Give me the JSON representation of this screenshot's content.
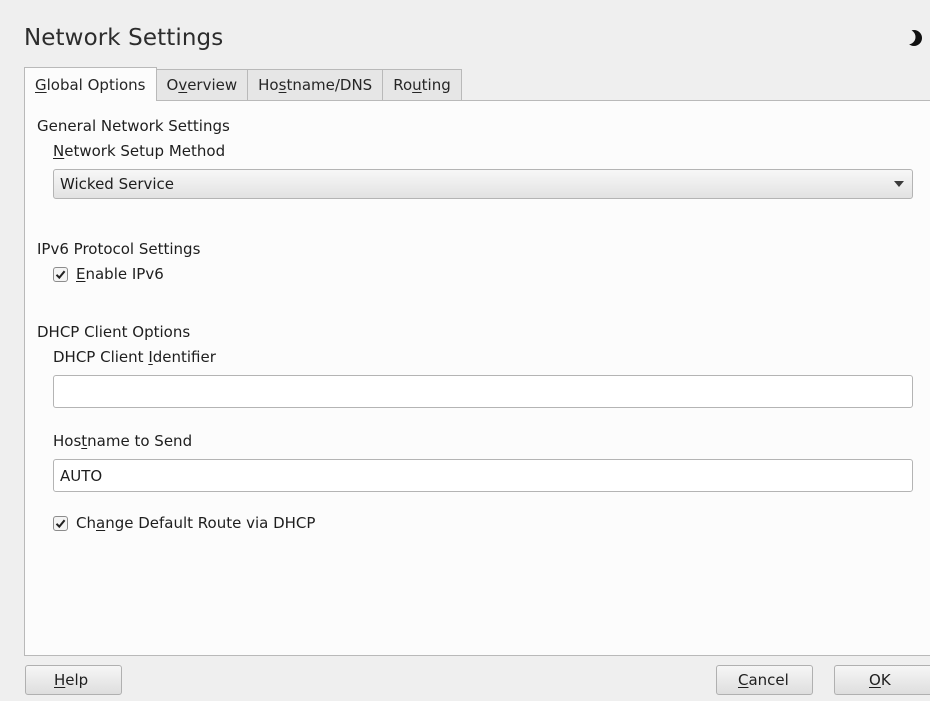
{
  "window": {
    "title": "Network Settings",
    "icon": "moon-icon"
  },
  "tabs": [
    {
      "pre": "",
      "key": "G",
      "post": "lobal Options",
      "active": true
    },
    {
      "pre": "O",
      "key": "v",
      "post": "erview",
      "active": false
    },
    {
      "pre": "Ho",
      "key": "s",
      "post": "tname/DNS",
      "active": false
    },
    {
      "pre": "Ro",
      "key": "u",
      "post": "ting",
      "active": false
    }
  ],
  "general": {
    "title": "General Network Settings",
    "setup_label": {
      "pre": "",
      "key": "N",
      "post": "etwork Setup Method"
    },
    "setup_method": "Wicked Service"
  },
  "ipv6": {
    "title": "IPv6 Protocol Settings",
    "enable": {
      "pre": "",
      "key": "E",
      "post": "nable IPv6",
      "checked": true
    }
  },
  "dhcp": {
    "title": "DHCP Client Options",
    "identifier_label": {
      "pre": "DHCP Client ",
      "key": "I",
      "post": "dentifier"
    },
    "identifier_value": "",
    "hostname_label": {
      "pre": "Hos",
      "key": "t",
      "post": "name to Send"
    },
    "hostname_value": "AUTO",
    "default_route": {
      "pre": "Ch",
      "key": "a",
      "post": "nge Default Route via DHCP",
      "checked": true
    }
  },
  "buttons": {
    "help": {
      "pre": "",
      "key": "H",
      "post": "elp"
    },
    "cancel": {
      "pre": "",
      "key": "C",
      "post": "ancel"
    },
    "ok": {
      "pre": "",
      "key": "O",
      "post": "K"
    }
  }
}
